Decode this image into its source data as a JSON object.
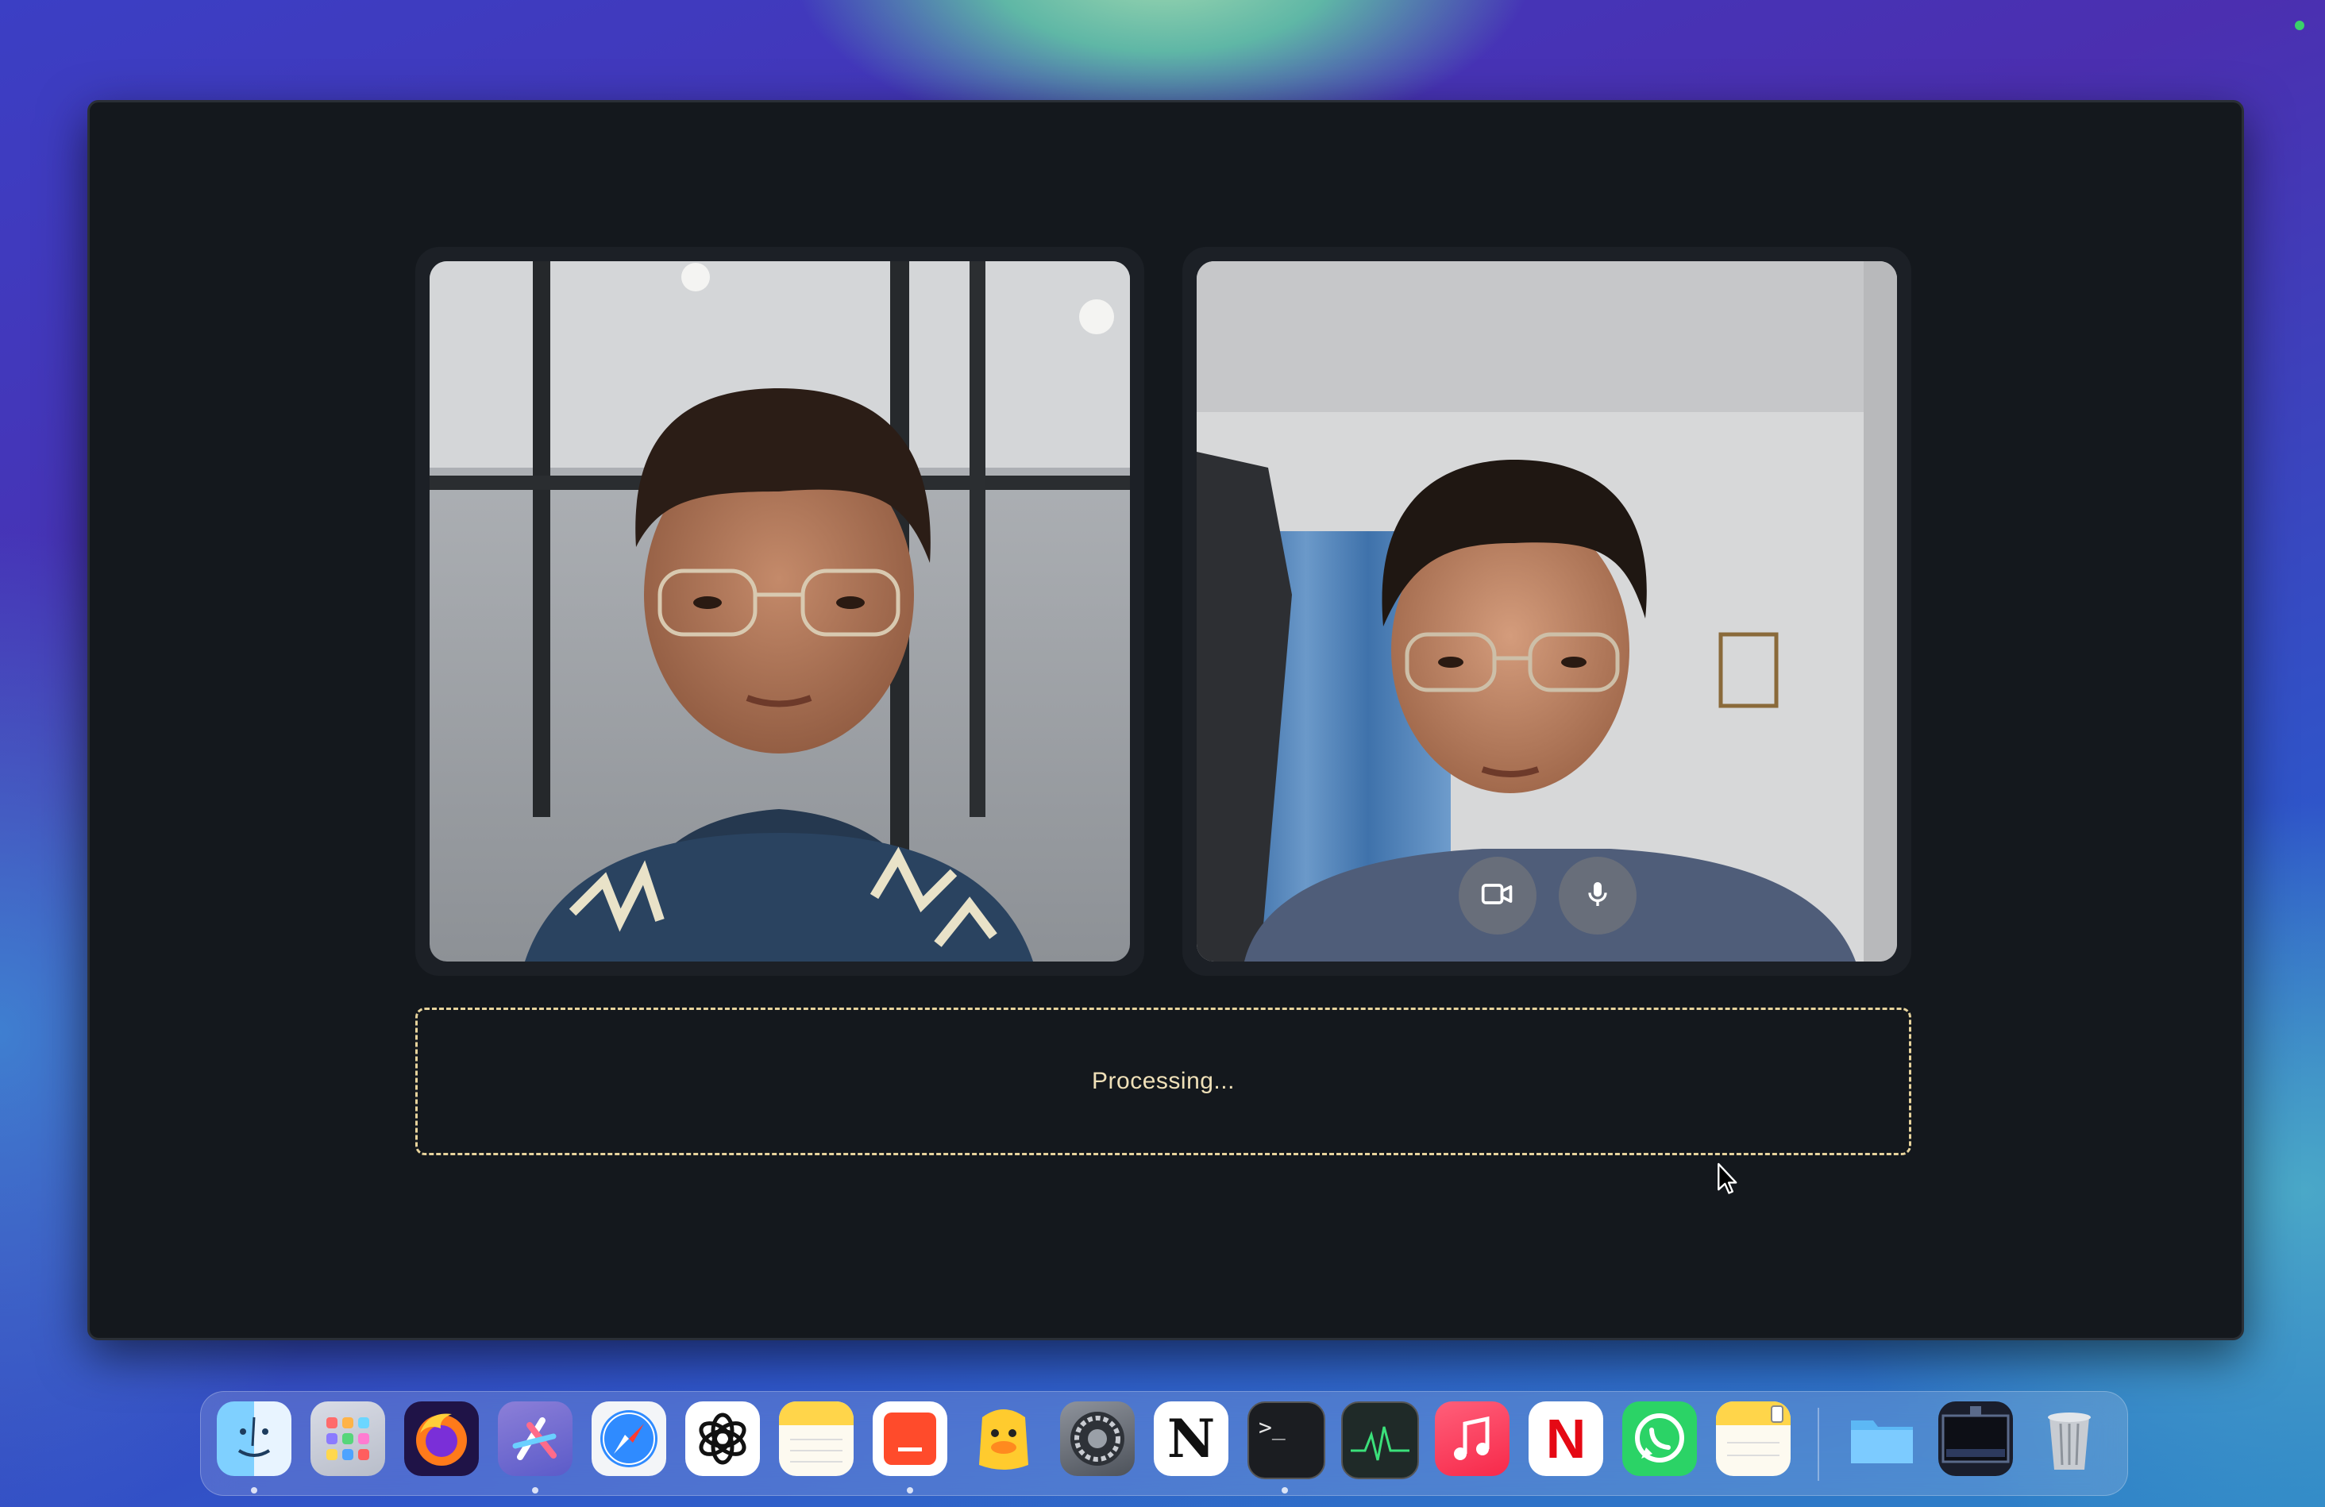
{
  "processing": {
    "text": "Processing..."
  },
  "video": {
    "left": {
      "label": ""
    },
    "right": {
      "label": ""
    },
    "controls": [
      {
        "icon": "video-camera-icon"
      },
      {
        "icon": "microphone-icon"
      }
    ]
  },
  "dock": {
    "apps": [
      {
        "name": "Finder",
        "icon": "finder-icon",
        "running": true
      },
      {
        "name": "Launchpad",
        "icon": "launchpad-icon",
        "running": false
      },
      {
        "name": "Firefox",
        "icon": "firefox-icon",
        "running": false
      },
      {
        "name": "Xcode",
        "icon": "xcode-icon",
        "running": true
      },
      {
        "name": "Safari",
        "icon": "safari-icon",
        "running": false
      },
      {
        "name": "ChatGPT",
        "icon": "chatgpt-icon",
        "running": false
      },
      {
        "name": "Notes",
        "icon": "notes-icon",
        "running": false
      },
      {
        "name": "Slides",
        "icon": "slides-icon",
        "running": true
      },
      {
        "name": "Cyberduck",
        "icon": "duck-icon",
        "running": false
      },
      {
        "name": "System Settings",
        "icon": "settings-icon",
        "running": false
      },
      {
        "name": "Notion",
        "icon": "notion-icon",
        "running": false
      },
      {
        "name": "Terminal",
        "icon": "terminal-icon",
        "running": true
      },
      {
        "name": "Activity Monitor",
        "icon": "activity-monitor-icon",
        "running": false
      },
      {
        "name": "Music",
        "icon": "music-icon",
        "running": false
      },
      {
        "name": "Netflix",
        "icon": "netflix-icon",
        "running": false
      },
      {
        "name": "WhatsApp",
        "icon": "whatsapp-icon",
        "running": false
      },
      {
        "name": "Notes",
        "icon": "notes-icon",
        "running": false
      },
      {
        "name": "Folder",
        "icon": "folder-icon",
        "running": false
      },
      {
        "name": "Screen Recording",
        "icon": "screen-icon",
        "running": false
      },
      {
        "name": "Trash",
        "icon": "trash-icon",
        "running": false
      }
    ],
    "notion_glyph": "N",
    "netflix_glyph": "N",
    "terminal_glyph": ">_"
  },
  "colors": {
    "window_bg": "#14181d",
    "processing_border": "#e7d39c"
  }
}
